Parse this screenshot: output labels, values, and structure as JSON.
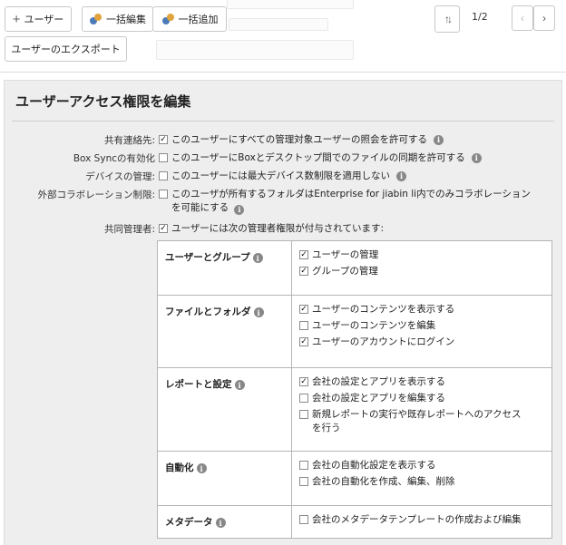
{
  "toolbar": {
    "add_user": "ユーザー",
    "bulk_edit": "一括編集",
    "bulk_add": "一括追加",
    "export_users": "ユーザーのエクスポート",
    "sort_icon": "sort-arrows-icon",
    "page": "1/2",
    "prev_icon": "chevron-left-icon",
    "next_icon": "chevron-right-icon"
  },
  "panel": {
    "title": "ユーザーアクセス権限を編集",
    "fields": [
      {
        "label": "共有連絡先:",
        "text": "このユーザーにすべての管理対象ユーザーの照会を許可する",
        "checked": true,
        "info": true
      },
      {
        "label": "Box Syncの有効化",
        "text": "このユーザーにBoxとデスクトップ間でのファイルの同期を許可する",
        "checked": false,
        "info": true
      },
      {
        "label": "デバイスの管理:",
        "text": "このユーザーには最大デバイス数制限を適用しない",
        "checked": false,
        "info": true
      },
      {
        "label": "外部コラボレーション制限:",
        "text": "このユーザが所有するフォルダはEnterprise for jiabin li内でのみコラボレーションを可能にする",
        "checked": false,
        "info": true
      },
      {
        "label": "共同管理者:",
        "text": "ユーザーには次の管理者権限が付与されています:",
        "checked": true,
        "info": false
      }
    ]
  },
  "permissions": [
    {
      "category": "ユーザーとグループ",
      "items": [
        {
          "text": "ユーザーの管理",
          "checked": true
        },
        {
          "text": "グループの管理",
          "checked": true
        }
      ]
    },
    {
      "category": "ファイルとフォルダ",
      "items": [
        {
          "text": "ユーザーのコンテンツを表示する",
          "checked": true
        },
        {
          "text": "ユーザーのコンテンツを編集",
          "checked": false
        },
        {
          "text": "ユーザーのアカウントにログイン",
          "checked": true
        }
      ]
    },
    {
      "category": "レポートと設定",
      "items": [
        {
          "text": "会社の設定とアプリを表示する",
          "checked": true
        },
        {
          "text": "会社の設定とアプリを編集する",
          "checked": false
        },
        {
          "text": "新規レポートの実行や既存レポートへのアクセスを行う",
          "checked": false
        }
      ]
    },
    {
      "category": "自動化",
      "items": [
        {
          "text": "会社の自動化設定を表示する",
          "checked": false
        },
        {
          "text": "会社の自動化を作成、編集、削除",
          "checked": false
        }
      ]
    },
    {
      "category": "メタデータ",
      "items": [
        {
          "text": "会社のメタデータテンプレートの作成および編集",
          "checked": false
        }
      ]
    }
  ]
}
